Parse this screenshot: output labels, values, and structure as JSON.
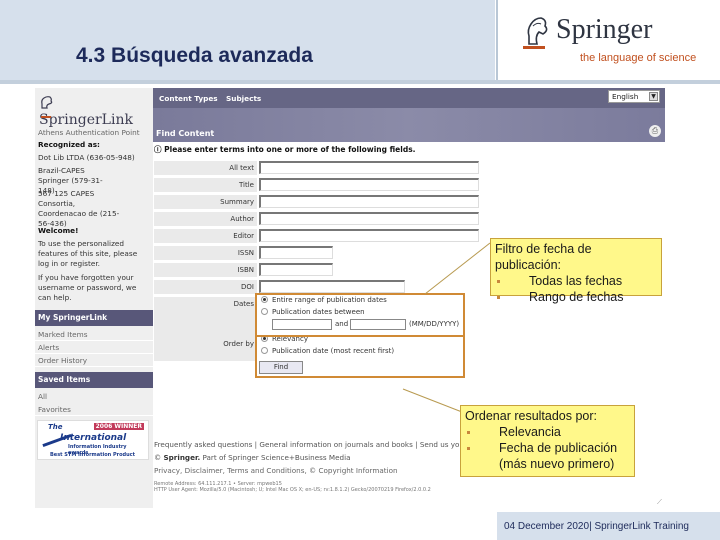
{
  "slide": {
    "title": "4.3 Búsqueda avanzada",
    "brand": {
      "name": "Springer",
      "tagline": "the language of science"
    },
    "footer": {
      "date": "04 December 2020",
      "separator": "|",
      "label": "SpringerLink Training"
    }
  },
  "colors": {
    "header_bg": "#d6e0ec",
    "title_color": "#1d2a5a",
    "brand_accent": "#c1501f",
    "nav_bg": "#585779",
    "highlight_border": "#d08a35",
    "callout_bg": "#fff88a"
  },
  "springerlink": {
    "logo": "SpringerLink",
    "sidebar": {
      "auth_point": "Athens Authentication Point",
      "recognized_label": "Recognized as:",
      "recognized": [
        "Dot Lib LTDA (636-05-948)",
        "Brazil-CAPES Springer (579-31-148)",
        "567 125 CAPES Consortia, Coordenacao de (215-56-436)"
      ],
      "welcome_title": "Welcome!",
      "welcome_text": "To use the personalized features of this site, please log in or register.",
      "forgot_text": "If you have forgotten your username or password, we can help.",
      "my_springerlink": "My SpringerLink",
      "my_items": [
        "Marked Items",
        "Alerts",
        "Order History"
      ],
      "saved_items": "Saved Items",
      "saved_links": [
        "All",
        "Favorites"
      ],
      "award": {
        "the": "The",
        "winner": "2006 WINNER",
        "international": "International",
        "line1": "Information Industry awards",
        "line2": "Best STM Information Product"
      }
    },
    "topnav": {
      "items": [
        "Content Types",
        "Subjects"
      ],
      "language": "English"
    },
    "banner_title": "Find Content",
    "instructions": "Please enter terms into one or more of the following fields.",
    "fields": [
      {
        "label": "All text",
        "value": ""
      },
      {
        "label": "Title",
        "value": ""
      },
      {
        "label": "Summary",
        "value": ""
      },
      {
        "label": "Author",
        "value": ""
      },
      {
        "label": "Editor",
        "value": ""
      },
      {
        "label": "ISSN",
        "value": ""
      },
      {
        "label": "ISBN",
        "value": ""
      },
      {
        "label": "DOI",
        "value": ""
      }
    ],
    "dates": {
      "label": "Dates",
      "option_all": "Entire range of publication dates",
      "option_between": "Publication dates between",
      "and": "and",
      "format": "(MM/DD/YYYY)",
      "from": "",
      "to": ""
    },
    "order": {
      "label": "Order by",
      "option_relevancy": "Relevancy",
      "option_date": "Publication date (most recent first)"
    },
    "find_button": "Find",
    "footer": {
      "links": "Frequently asked questions | General information on journals and books | Send us your feedback",
      "copyright_brand": "Springer.",
      "copyright_rest": "Part of Springer Science+Business Media",
      "privacy": "Privacy, Disclaimer, Terms and Conditions, © Copyright Information",
      "remote": "Remote Address: 64.111.217.1 • Server: mpweb15",
      "agent": "HTTP User Agent: Mozilla/5.0 (Macintosh; U; Intel Mac OS X; en-US; rv:1.8.1.2) Gecko/20070219 Firefox/2.0.0.2"
    }
  },
  "callouts": {
    "dates": {
      "title": "Filtro de fecha de publicación:",
      "items": [
        "Todas las fechas",
        "Rango de fechas"
      ]
    },
    "order": {
      "title": "Ordenar resultados por:",
      "items": [
        "Relevancia",
        "Fecha de publicación (más nuevo primero)"
      ]
    }
  }
}
